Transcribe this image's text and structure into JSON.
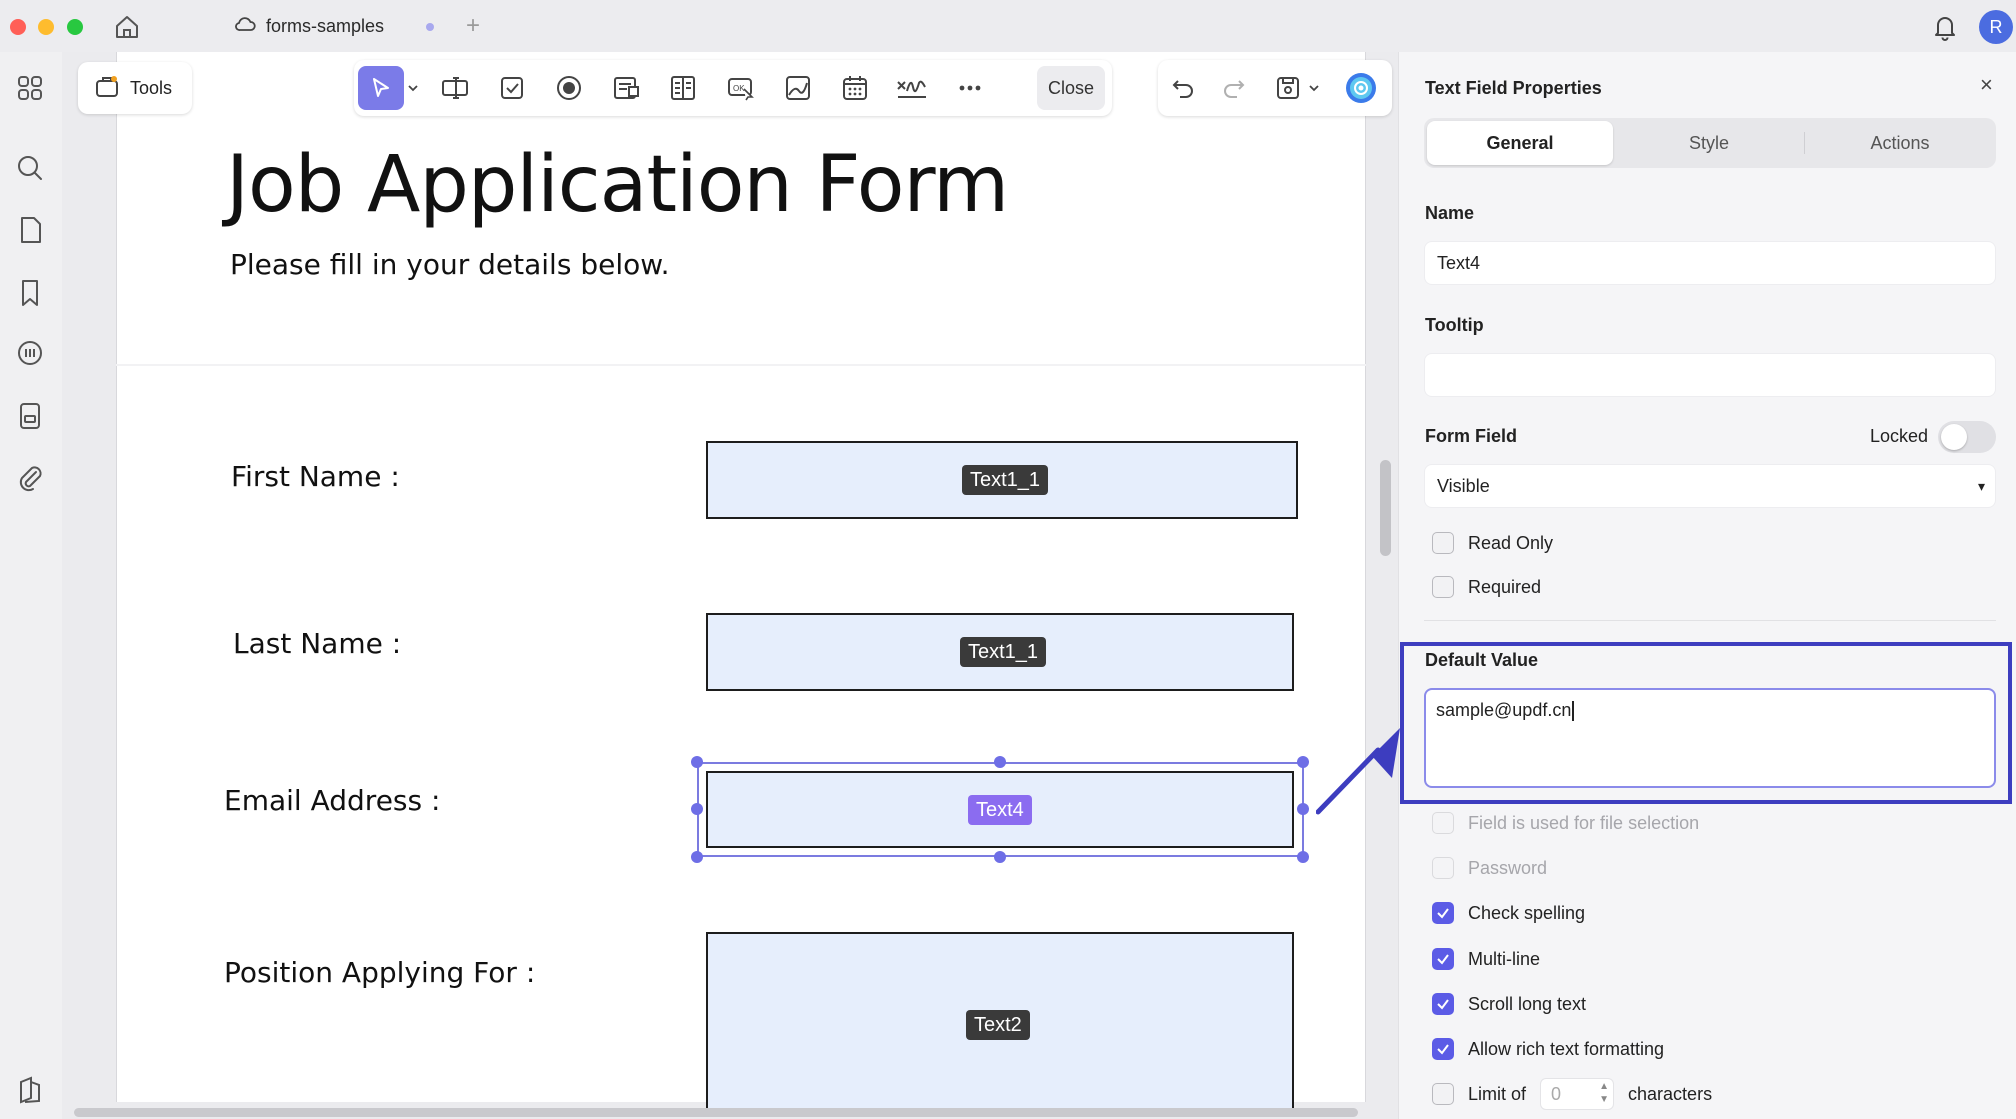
{
  "window": {
    "tab_title": "forms-samples",
    "new_tab_symbol": "+",
    "avatar_initial": "R"
  },
  "left_rail": {
    "icons": [
      "grid-icon",
      "search-icon",
      "pages-icon",
      "bookmark-icon",
      "comment-icon",
      "form-icon",
      "attachment-icon",
      "layers-icon"
    ]
  },
  "toolbar": {
    "tools_label": "Tools",
    "close_label": "Close",
    "form_tools": [
      "select-arrow-icon",
      "text-field-icon",
      "checkbox-icon",
      "radio-button-icon",
      "combo-box-icon",
      "list-box-icon",
      "button-icon",
      "image-field-icon",
      "date-field-icon",
      "signature-icon",
      "more-icon"
    ]
  },
  "document": {
    "title": "Job Application Form",
    "subtitle": "Please fill in your details below.",
    "fields": [
      {
        "label": "First Name :",
        "chip": "Text1_1",
        "selected": false
      },
      {
        "label": "Last Name :",
        "chip": "Text1_1",
        "selected": false
      },
      {
        "label": "Email Address :",
        "chip": "Text4",
        "selected": true
      },
      {
        "label": "Position Applying For :",
        "chip": "Text2",
        "selected": false
      }
    ]
  },
  "panel": {
    "title": "Text Field Properties",
    "close_symbol": "×",
    "tabs": [
      "General",
      "Style",
      "Actions"
    ],
    "active_tab": "General",
    "name_label": "Name",
    "name_value": "Text4",
    "tooltip_label": "Tooltip",
    "tooltip_value": "",
    "form_field_label": "Form Field",
    "locked_label": "Locked",
    "locked": false,
    "visibility_value": "Visible",
    "read_only_label": "Read Only",
    "required_label": "Required",
    "default_value_label": "Default Value",
    "default_value": "sample@updf.cn",
    "options": [
      {
        "label": "Field is used for file selection",
        "checked": false,
        "disabled": true
      },
      {
        "label": "Password",
        "checked": false,
        "disabled": true
      },
      {
        "label": "Check spelling",
        "checked": true,
        "disabled": false
      },
      {
        "label": "Multi-line",
        "checked": true,
        "disabled": false
      },
      {
        "label": "Scroll long text",
        "checked": true,
        "disabled": false
      },
      {
        "label": "Allow rich text formatting",
        "checked": true,
        "disabled": false
      }
    ],
    "limit_prefix": "Limit of",
    "limit_value": "0",
    "limit_suffix": "characters"
  },
  "colors": {
    "accent": "#5b5be6",
    "highlight_border": "#3d3dbf",
    "field_fill": "#e6eefc",
    "selected_chip": "#8b6cf0"
  }
}
